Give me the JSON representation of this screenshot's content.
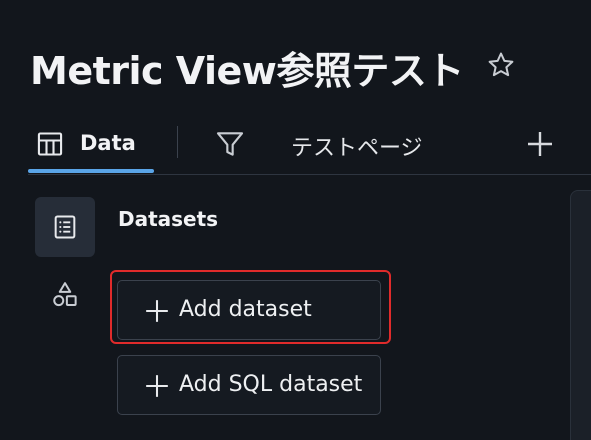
{
  "header": {
    "title": "Metric View参照テスト",
    "star_icon": "star-outline-icon"
  },
  "tabs": {
    "data_label": "Data",
    "data_icon": "table-grid-icon",
    "filter_icon": "filter-funnel-icon",
    "page_label": "テストページ",
    "add_icon": "plus-icon"
  },
  "sidebar": {
    "items": [
      {
        "icon": "dataset-list-icon",
        "active": true
      },
      {
        "icon": "shapes-icon",
        "active": false
      }
    ]
  },
  "datasets": {
    "heading": "Datasets",
    "add_dataset_label": "Add dataset",
    "add_sql_dataset_label": "Add SQL dataset"
  },
  "colors": {
    "background": "#12161c",
    "active_underline": "#5aa5e8",
    "highlight_border": "#e02b2b",
    "active_sidebar_bg": "#262d38"
  }
}
